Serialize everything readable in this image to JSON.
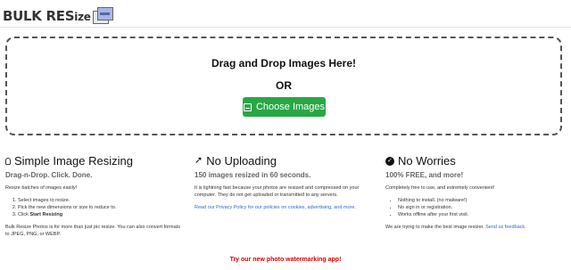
{
  "header": {
    "logo_text_1": "BULK",
    "logo_text_2": "RES",
    "logo_text_3": "ize",
    "logo_icon": "photos-icon"
  },
  "dropzone": {
    "title": "Drag and Drop Images Here!",
    "or_text": "OR",
    "button_label": "Choose Images",
    "button_color": "#28a745"
  },
  "features": {
    "simple": {
      "title": "Simple Image Resizing",
      "subtitle": "Drag-n-Drop. Click. Done.",
      "intro": "Resize batches of images easily!",
      "steps": [
        "Select images to resize.",
        "Pick the new dimensions or size to reduce to.",
        "Click "
      ],
      "step3_bold": "Start Resizing",
      "footer": "Bulk Resize Photos is for more than just pic resize. You can also convert formats to JPEG, PNG, or WEBP."
    },
    "no_upload": {
      "title": "No Uploading",
      "subtitle": "150 images resized in 60 seconds.",
      "body": "It is lightning fast because your photos are resized and compressed on your computer. They do not get uploaded or transmitted to any servers.",
      "link": "Read our Privacy Policy for our policies on cookies, advertising, and more."
    },
    "no_worries": {
      "title": "No Worries",
      "subtitle": "100% FREE, and more!",
      "body": "Completely free to use, and extremely convenient!",
      "bullets": [
        "Nothing to install. (no malware!)",
        "No sign in or registration.",
        "Works offline after your first visit."
      ],
      "footer_text": "We are trying to make the best image resizer.",
      "footer_link": "Send us feedback."
    }
  },
  "promo": {
    "text": "Try our new photo watermarking app!",
    "color": "#e00000"
  }
}
